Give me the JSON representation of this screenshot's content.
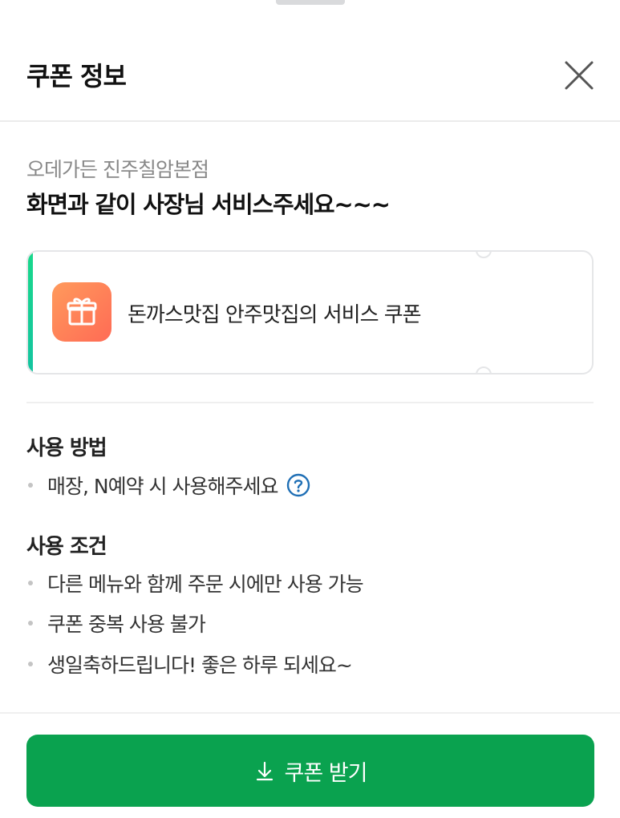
{
  "header": {
    "title": "쿠폰 정보",
    "close_icon": "close-icon"
  },
  "store": {
    "name": "오데가든 진주칠암본점",
    "headline": "화면과 같이 사장님 서비스주세요~~~"
  },
  "coupon": {
    "icon": "gift-icon",
    "label": "돈까스맛집 안주맛집의 서비스 쿠폰",
    "accent_color": "#19d88b",
    "icon_color": "#ff7a57"
  },
  "usage_method": {
    "title": "사용 방법",
    "items": [
      "매장, N예약 시 사용해주세요"
    ],
    "help_icon": "question-circle-icon"
  },
  "usage_conditions": {
    "title": "사용 조건",
    "items": [
      "다른 메뉴와 함께 주문 시에만 사용 가능",
      "쿠폰 중복 사용 불가",
      "생일축하드립니다! 좋은 하루 되세요~"
    ]
  },
  "footer": {
    "download_label": "쿠폰 받기",
    "download_icon": "download-arrow-icon",
    "button_color": "#0aa24f"
  }
}
